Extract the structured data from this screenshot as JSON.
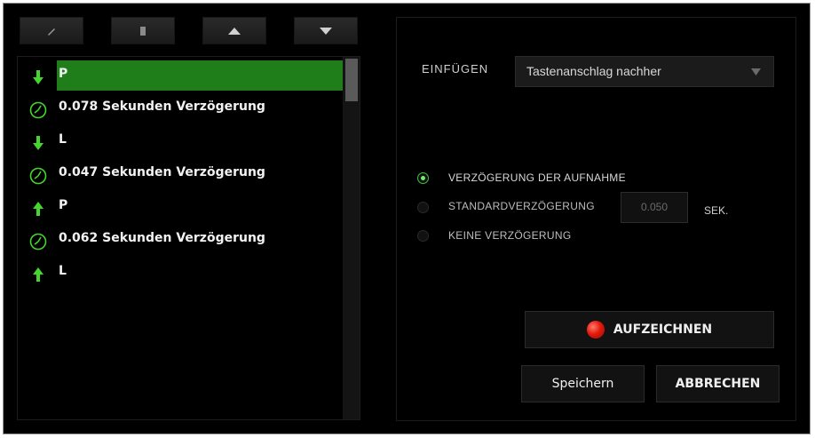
{
  "toolbar": {
    "buttons": [
      {
        "icon": "pencil-icon"
      },
      {
        "icon": "trash-icon"
      },
      {
        "icon": "arrow-up-icon"
      },
      {
        "icon": "arrow-down-icon"
      }
    ]
  },
  "macro_list": {
    "items": [
      {
        "icon": "key-down-arrow-icon",
        "text": "P",
        "selected": true
      },
      {
        "icon": "clock-icon",
        "text": "0.078 Sekunden Verzögerung",
        "selected": false
      },
      {
        "icon": "key-down-arrow-icon",
        "text": "L",
        "selected": false
      },
      {
        "icon": "clock-icon",
        "text": "0.047 Sekunden Verzögerung",
        "selected": false
      },
      {
        "icon": "key-up-arrow-icon",
        "text": "P",
        "selected": false
      },
      {
        "icon": "clock-icon",
        "text": "0.062 Sekunden Verzögerung",
        "selected": false
      },
      {
        "icon": "key-up-arrow-icon",
        "text": "L",
        "selected": false
      }
    ]
  },
  "insert": {
    "label": "EINFÜGEN",
    "selected": "Tastenanschlag nachher"
  },
  "delay_options": {
    "record_delay": "VERZÖGERUNG DER AUFNAHME",
    "default_delay": "STANDARDVERZÖGERUNG",
    "no_delay": "KEINE VERZÖGERUNG",
    "selected": "record_delay",
    "default_value": "0.050",
    "unit": "SEK."
  },
  "buttons": {
    "record": "AUFZEICHNEN",
    "save": "Speichern",
    "cancel": "ABBRECHEN"
  },
  "colors": {
    "accent_green": "#44d62c",
    "selection": "#1f7d1a",
    "record_red": "#e31a0c"
  }
}
